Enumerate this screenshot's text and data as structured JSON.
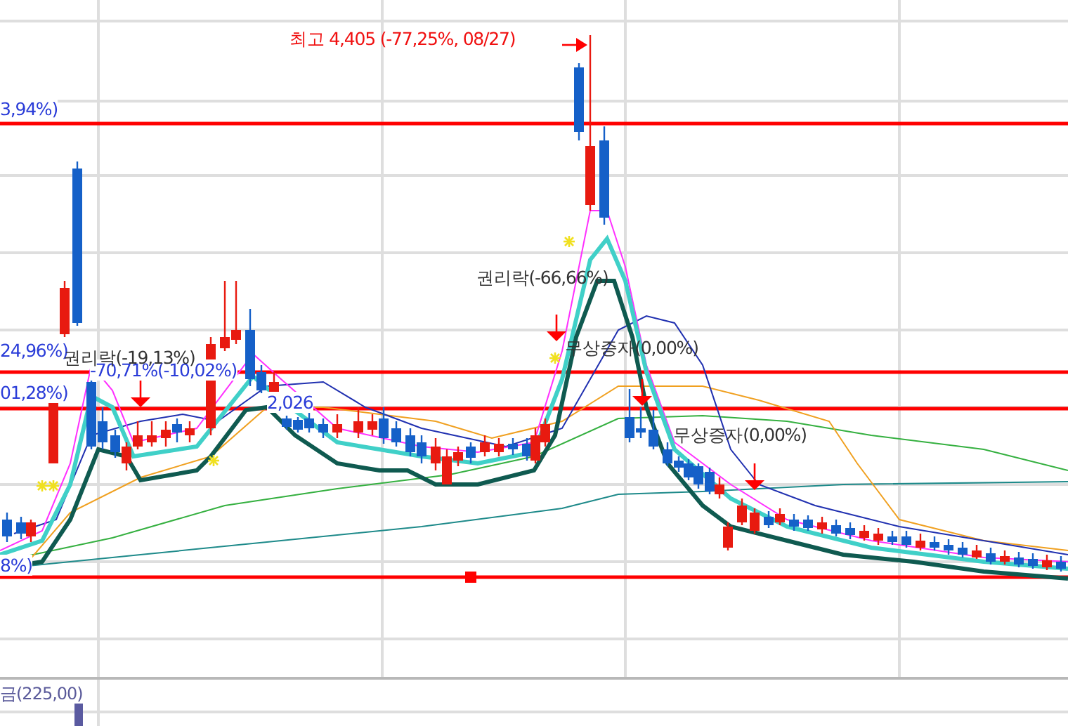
{
  "chart": {
    "labels": [
      {
        "kind": "high",
        "text": "최고 4,405 (-77,25%, 08/27)"
      },
      {
        "kind": "ratio",
        "text": "3,94%)"
      },
      {
        "kind": "ratio",
        "text": "24,96%)"
      },
      {
        "kind": "ratio",
        "text": "01,28%)"
      },
      {
        "kind": "ratio",
        "text": "-70,71%(-10,02%)"
      },
      {
        "kind": "ratio",
        "text": "2,026"
      },
      {
        "kind": "ratio",
        "text": "8%)"
      },
      {
        "kind": "event",
        "text": "권리락(-19,13%)"
      },
      {
        "kind": "event",
        "text": "권리락(-66,66%)"
      },
      {
        "kind": "event",
        "text": "무상증자(0,00%)"
      },
      {
        "kind": "event",
        "text": "무상증자(0,00%)"
      }
    ]
  },
  "volume": {
    "label": "금(225,00)"
  }
}
